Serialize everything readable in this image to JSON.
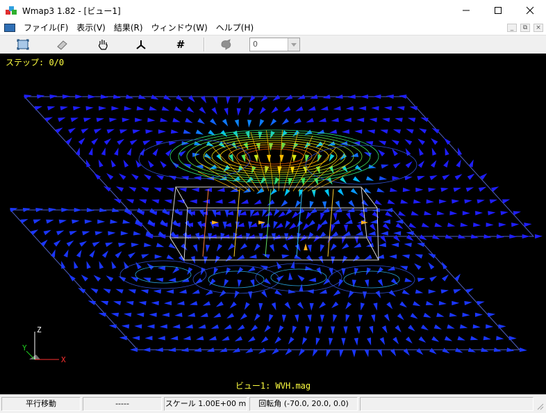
{
  "window": {
    "title": "Wmap3 1.82 - [ビュー1]",
    "minimize_icon": "minimize-icon",
    "maximize_icon": "maximize-icon",
    "close_icon": "close-icon"
  },
  "menu": {
    "items": [
      {
        "label": "ファイル(F)"
      },
      {
        "label": "表示(V)"
      },
      {
        "label": "結果(R)"
      },
      {
        "label": "ウィンドウ(W)"
      },
      {
        "label": "ヘルプ(H)"
      }
    ]
  },
  "toolbar": {
    "hash_label": "#",
    "step_value": "0"
  },
  "viewport": {
    "step_label": "ステップ: 0/0",
    "view_label": "ビュー1: WVH.mag",
    "axis_x": "X",
    "axis_y": "Y",
    "axis_z": "Z",
    "axis_x_color": "#ff3030",
    "axis_y_color": "#20d020",
    "axis_z_color": "#ffffff",
    "field_color": "#1a1aff",
    "background": "#000000"
  },
  "status": {
    "mode": "平行移動",
    "pane2": "-----",
    "scale": "スケール 1.00E+00 m",
    "rotation": "回転角 (-70.0, 20.0, 0.0)"
  }
}
